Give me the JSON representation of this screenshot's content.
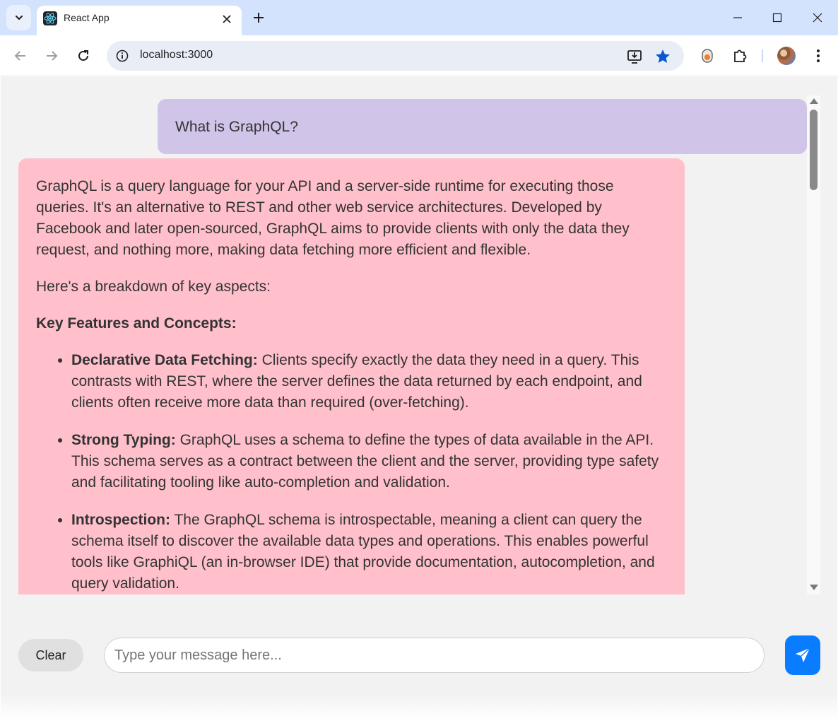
{
  "browser": {
    "tab_title": "React App",
    "url": "localhost:3000",
    "icons": {
      "tab_menu": "chevron-down-icon",
      "favicon": "react-logo-icon",
      "tab_close": "close-icon",
      "new_tab": "plus-icon",
      "minimize": "minimize-icon",
      "maximize": "maximize-icon",
      "close_window": "close-icon",
      "back": "arrow-left-icon",
      "forward": "arrow-right-icon",
      "reload": "reload-icon",
      "site_info": "info-icon",
      "install": "install-app-icon",
      "bookmark": "star-icon",
      "extension_pin": "extension-pin-icon",
      "extensions": "puzzle-icon",
      "profile": "avatar",
      "menu": "kebab-menu-icon"
    },
    "colors": {
      "tabbar": "#d3e3fd",
      "star": "#0b57d0"
    }
  },
  "chat": {
    "user_message": "What is GraphQL?",
    "bot_message": {
      "paragraphs": [
        "GraphQL is a query language for your API and a server-side runtime for executing those queries. It's an alternative to REST and other web service architectures. Developed by Facebook and later open-sourced, GraphQL aims to provide clients with only the data they request, and nothing more, making data fetching more efficient and flexible.",
        "Here's a breakdown of key aspects:"
      ],
      "heading": "Key Features and Concepts:",
      "items": [
        {
          "term": "Declarative Data Fetching:",
          "text": " Clients specify exactly the data they need in a query. This contrasts with REST, where the server defines the data returned by each endpoint, and clients often receive more data than required (over-fetching)."
        },
        {
          "term": "Strong Typing:",
          "text": " GraphQL uses a schema to define the types of data available in the API. This schema serves as a contract between the client and the server, providing type safety and facilitating tooling like auto-completion and validation."
        },
        {
          "term": "Introspection:",
          "text": " The GraphQL schema is introspectable, meaning a client can query the schema itself to discover the available data types and operations. This enables powerful tools like GraphiQL (an in-browser IDE) that provide documentation, autocompletion, and query validation."
        }
      ]
    },
    "colors": {
      "user_bubble": "#d1c4e9",
      "bot_bubble": "#ffc0cb",
      "send_button": "#0a7cff"
    }
  },
  "composer": {
    "clear_label": "Clear",
    "input_value": "",
    "input_placeholder": "Type your message here...",
    "send_icon": "paper-plane-icon"
  }
}
